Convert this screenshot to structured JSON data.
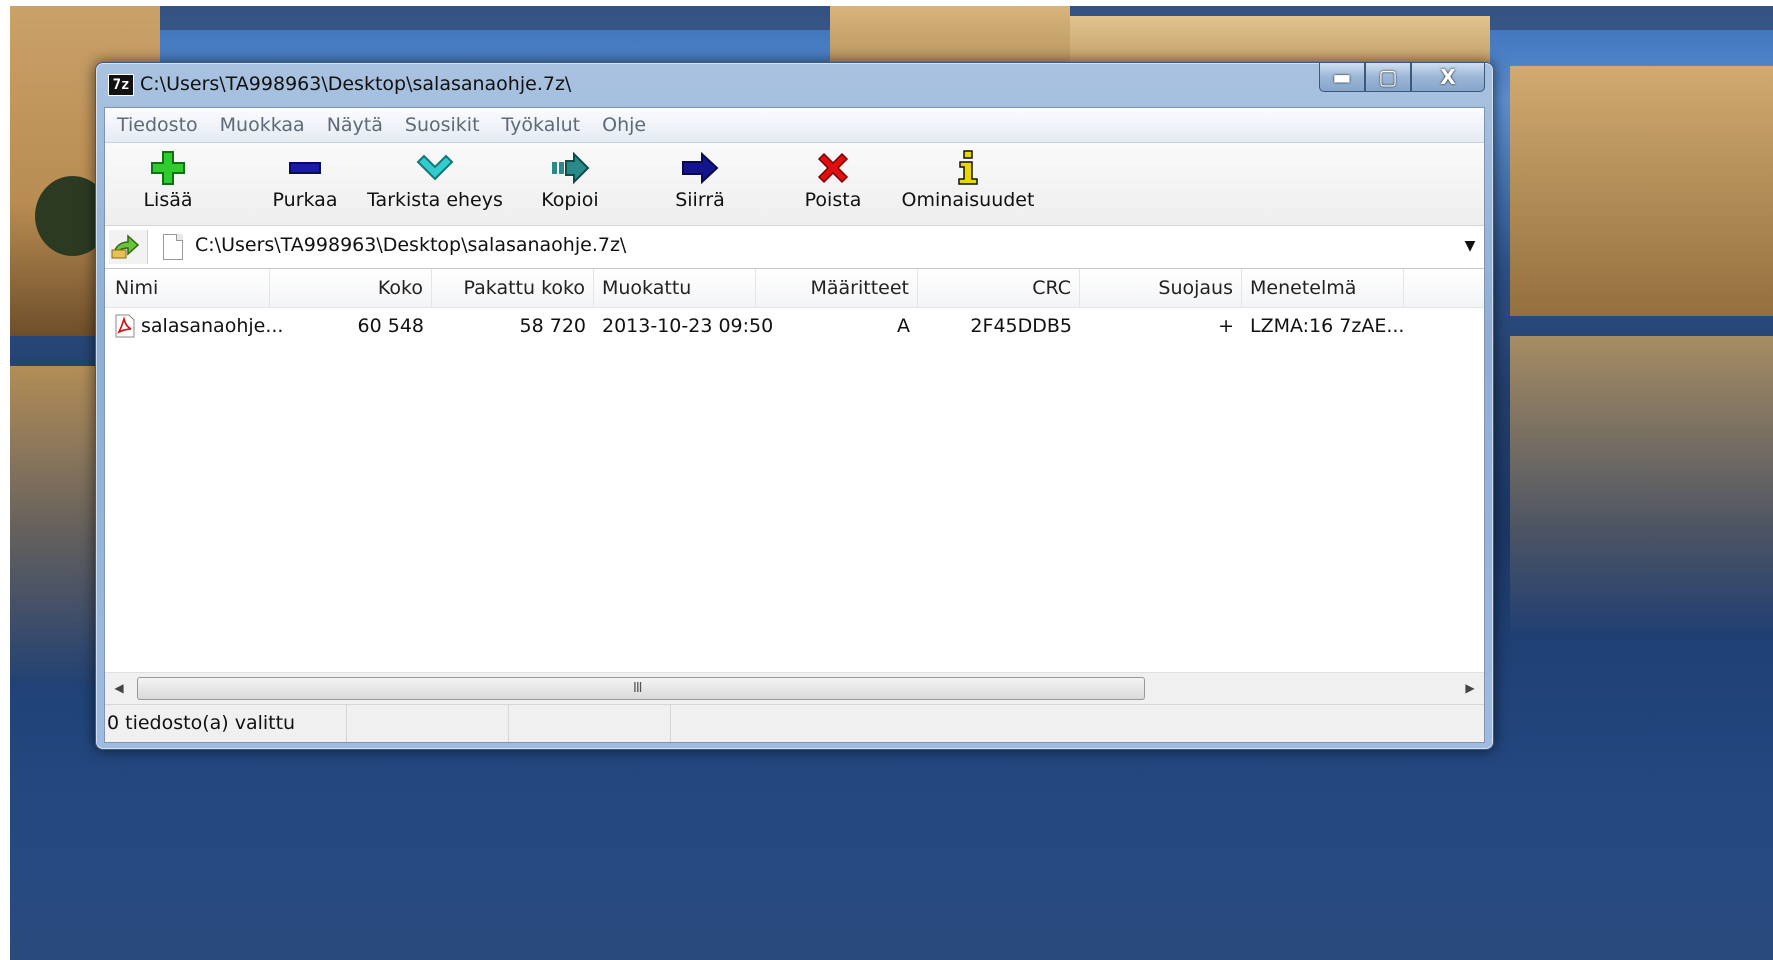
{
  "window": {
    "app_icon_text": "7z",
    "title": "C:\\Users\\TA998963\\Desktop\\salasanaohje.7z\\",
    "minimize_glyph": "▬",
    "maximize_glyph": "▢",
    "close_glyph": "X"
  },
  "menu": [
    "Tiedosto",
    "Muokkaa",
    "Näytä",
    "Suosikit",
    "Työkalut",
    "Ohje"
  ],
  "toolbar": {
    "add": "Lisää",
    "extract": "Purkaa",
    "test": "Tarkista eheys",
    "copy": "Kopioi",
    "move": "Siirrä",
    "delete": "Poista",
    "info": "Ominaisuudet"
  },
  "address": {
    "path": "C:\\Users\\TA998963\\Desktop\\salasanaohje.7z\\",
    "dropdown_glyph": "▼"
  },
  "columns": [
    "Nimi",
    "Koko",
    "Pakattu koko",
    "Muokattu",
    "Määritteet",
    "CRC",
    "Suojaus",
    "Menetelmä"
  ],
  "rows": [
    {
      "name": "salasanaohje...",
      "size": "60 548",
      "packed": "58 720",
      "modified": "2013-10-23 09:50",
      "attributes": "A",
      "crc": "2F45DDB5",
      "encrypted": "+",
      "method": "LZMA:16 7zAE..."
    }
  ],
  "scrollbar": {
    "left_glyph": "◀",
    "right_glyph": "▶",
    "grip": "III"
  },
  "status": {
    "selected": "0 tiedosto(a) valittu"
  },
  "colors": {
    "add_icon": "#2ecc2e",
    "extract_icon": "#1a1aa8",
    "test_icon": "#33cccc",
    "copy_icon": "#2a8a8a",
    "move_icon": "#14148f",
    "delete_icon": "#e01010",
    "info_icon": "#e8d800"
  }
}
